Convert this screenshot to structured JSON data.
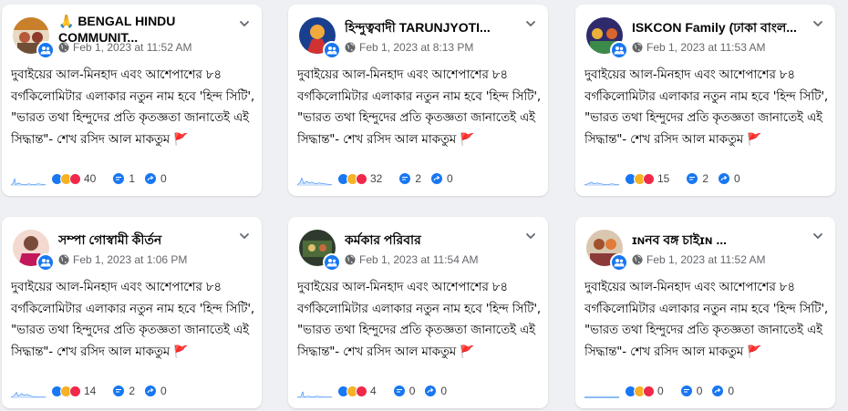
{
  "colors": {
    "accent": "#1877f2",
    "flag": "#e0292e",
    "meta": "#65676b"
  },
  "post_text": "দুবাইয়ের আল-মিনহাদ এবং আশেপাশের ৮৪ বর্গকিলোমিটার এলাকার নতুন নাম হবে 'হিন্দ সিটি', \"ভারত তথা হিন্দুদের প্রতি কৃতজ্ঞতা জানাতেই এই সিদ্ধান্ত\"- শেখ রসিদ আল মাকতুম",
  "cards": [
    {
      "name": "🙏 BENGAL HINDU COMMUNIT...",
      "time": "Feb 1, 2023 at 11:52 AM",
      "reactions": "40",
      "comments": "1",
      "shares": "0",
      "avatar_icon": "group-photo-icon"
    },
    {
      "name": "হিন্দুত্ববাদী TARUNJYOTI...",
      "time": "Feb 1, 2023 at 8:13 PM",
      "reactions": "32",
      "comments": "2",
      "shares": "0",
      "avatar_icon": "deity-photo-icon"
    },
    {
      "name": "ISKCON Family (ঢাকা বাংল...",
      "time": "Feb 1, 2023 at 11:53 AM",
      "reactions": "15",
      "comments": "2",
      "shares": "0",
      "avatar_icon": "deity-photo-icon"
    },
    {
      "name": "সম্পা গোস্বামী কীর্তন",
      "time": "Feb 1, 2023 at 1:06 PM",
      "reactions": "14",
      "comments": "2",
      "shares": "0",
      "avatar_icon": "person-photo-icon"
    },
    {
      "name": "কর্মকার পরিবার",
      "time": "Feb 1, 2023 at 11:54 AM",
      "reactions": "4",
      "comments": "0",
      "shares": "0",
      "avatar_icon": "group-photo-icon"
    },
    {
      "name": "ɪɴনব বঙ্গ চাইɪɴ ...",
      "time": "Feb 1, 2023 at 11:52 AM",
      "reactions": "0",
      "comments": "0",
      "shares": "0",
      "avatar_icon": "person-photo-icon"
    }
  ]
}
